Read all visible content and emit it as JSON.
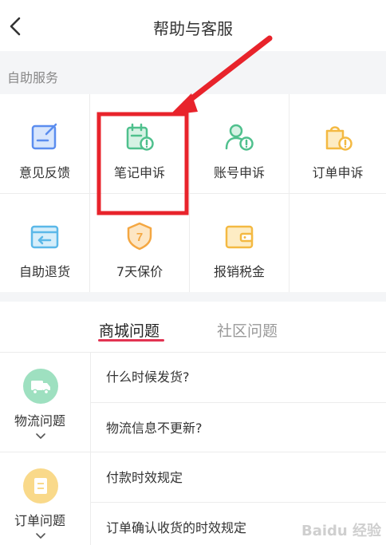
{
  "header": {
    "title": "帮助与客服",
    "back_icon": "chevron-left-icon"
  },
  "self_service": {
    "label": "自助服务",
    "items": [
      {
        "label": "意见反馈",
        "icon": "feedback-icon",
        "color": "#5b8def"
      },
      {
        "label": "笔记申诉",
        "icon": "note-appeal-icon",
        "color": "#4fc08d"
      },
      {
        "label": "账号申诉",
        "icon": "account-appeal-icon",
        "color": "#4fc08d"
      },
      {
        "label": "订单申诉",
        "icon": "order-appeal-icon",
        "color": "#f4b942"
      },
      {
        "label": "自助退货",
        "icon": "return-box-icon",
        "color": "#5bb8e8"
      },
      {
        "label": "7天保价",
        "icon": "price-protect-shield-icon",
        "color": "#f4a742",
        "badge": "7"
      },
      {
        "label": "报销税金",
        "icon": "wallet-icon",
        "color": "#f4b942"
      }
    ]
  },
  "tabs": [
    {
      "label": "商城问题",
      "active": true
    },
    {
      "label": "社区问题",
      "active": false
    }
  ],
  "accent_color": "#e23352",
  "faq": {
    "categories": [
      {
        "name": "物流问题",
        "icon": "truck-icon",
        "color": "#9ee0c0"
      },
      {
        "name": "订单问题",
        "icon": "order-doc-icon",
        "color": "#f9d98a"
      }
    ],
    "questions": [
      "什么时候发货?",
      "物流信息不更新?",
      "付款时效规定",
      "订单确认收货的时效规定"
    ]
  },
  "annotation": {
    "highlight_color": "#e8232b"
  },
  "watermark": "Baidu 经验"
}
